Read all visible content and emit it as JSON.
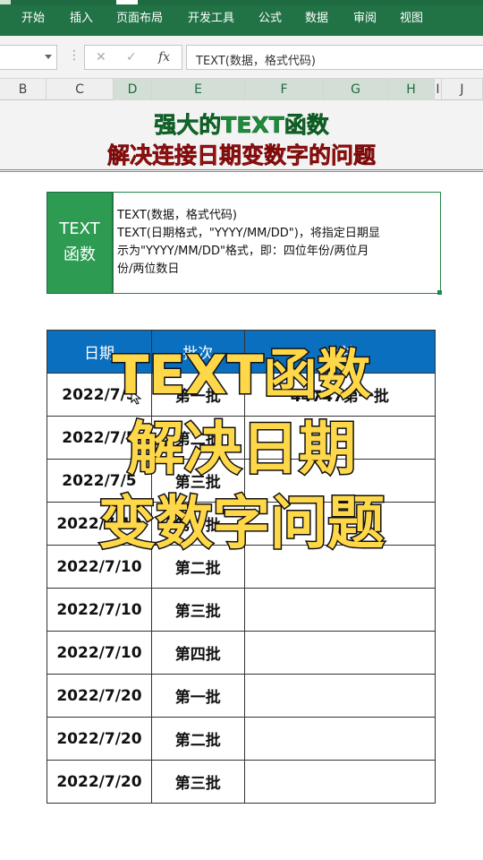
{
  "ribbon": {
    "menu": [
      "开始",
      "插入",
      "页面布局",
      "开发工具",
      "公式",
      "数据",
      "审阅",
      "视图"
    ]
  },
  "formula_bar": {
    "namebox_value": "",
    "cancel_icon": "cancel-icon",
    "enter_icon": "check-icon",
    "fx_label": "fx",
    "formula": "TEXT(数据，格式代码)"
  },
  "columns": [
    "B",
    "C",
    "D",
    "E",
    "F",
    "G",
    "H",
    "I",
    "J"
  ],
  "banner": {
    "line1": "强大的TEXT函数",
    "line2": "解决连接日期变数字的问题"
  },
  "info": {
    "label_line1": "TEXT",
    "label_line2": "函数",
    "line1": "TEXT(数据，格式代码)",
    "line2": "TEXT(日期格式，\"YYYY/MM/DD\")，将指定日期显",
    "line3": "示为\"YYYY/MM/DD\"格式，即：四位年份/两位月",
    "line4": "份/两位数日"
  },
  "table": {
    "headers": [
      "日期",
      "批次",
      "合并"
    ],
    "rows": [
      {
        "date": "2022/7/5",
        "batch": "第一批",
        "merge": "44747第一批"
      },
      {
        "date": "2022/7/5",
        "batch": "第二批",
        "merge": ""
      },
      {
        "date": "2022/7/5",
        "batch": "第三批",
        "merge": ""
      },
      {
        "date": "2022/7/10",
        "batch": "第一批",
        "merge": ""
      },
      {
        "date": "2022/7/10",
        "batch": "第二批",
        "merge": ""
      },
      {
        "date": "2022/7/10",
        "batch": "第三批",
        "merge": ""
      },
      {
        "date": "2022/7/10",
        "batch": "第四批",
        "merge": ""
      },
      {
        "date": "2022/7/20",
        "batch": "第一批",
        "merge": ""
      },
      {
        "date": "2022/7/20",
        "batch": "第二批",
        "merge": ""
      },
      {
        "date": "2022/7/20",
        "batch": "第三批",
        "merge": ""
      }
    ]
  },
  "overlay": {
    "line1": "TEXT函数",
    "line2": "解决日期",
    "line3": "变数字问题"
  },
  "colors": {
    "ribbon": "#217346",
    "table_header": "#0a6fbf",
    "label_green": "#2e9b52",
    "overlay_yellow": "#ffd84a",
    "merge_red": "#d01010"
  }
}
